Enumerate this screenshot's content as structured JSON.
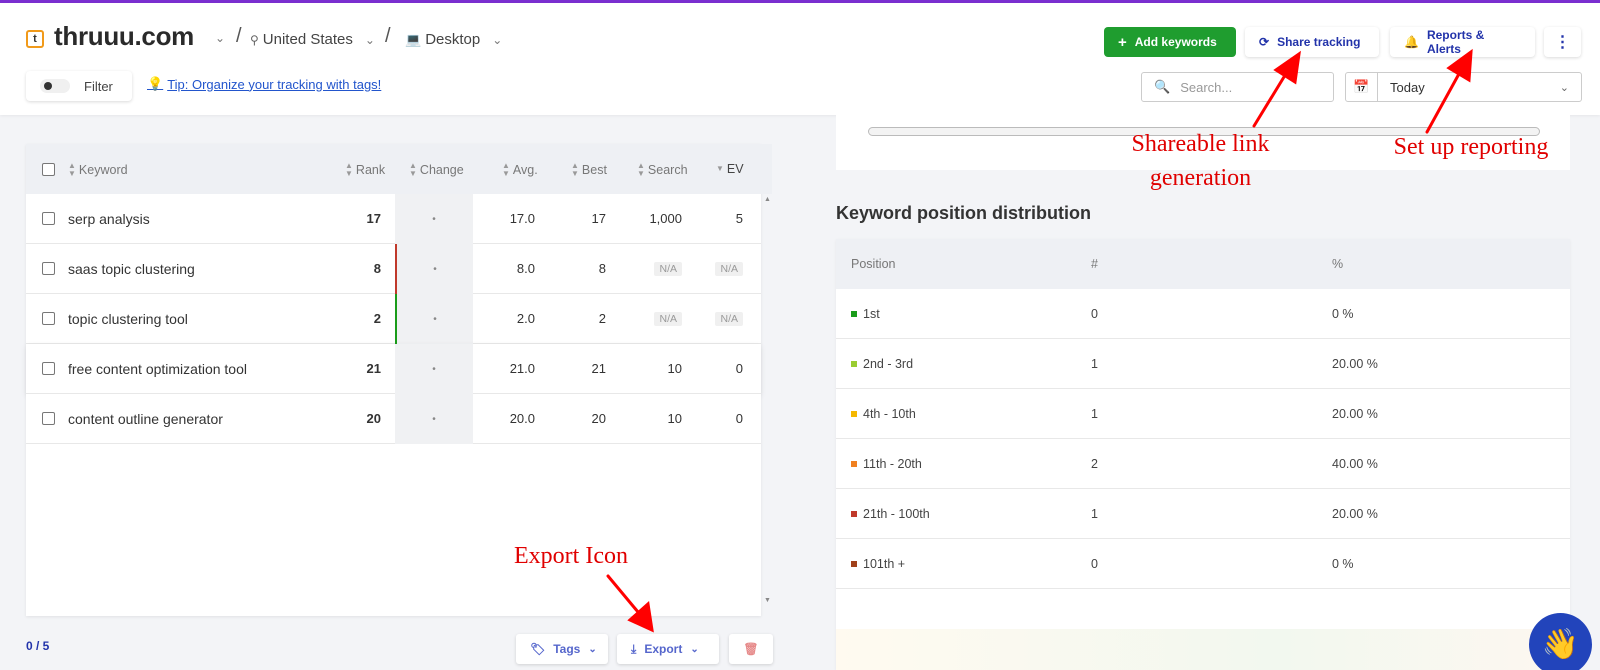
{
  "header": {
    "site_name": "thruuu.com",
    "location": "United States",
    "device": "Desktop",
    "filter_label": "Filter",
    "tip": "Tip: Organize your tracking with tags!",
    "add_keywords": "Add keywords",
    "share_tracking": "Share tracking",
    "reports_alerts": "Reports & Alerts",
    "search_placeholder": "Search...",
    "date": "Today"
  },
  "table": {
    "columns": [
      "Keyword",
      "Rank",
      "Change",
      "Avg.",
      "Best",
      "Search",
      "EV"
    ],
    "rows": [
      {
        "keyword": "serp analysis",
        "rank": "17",
        "change": "•",
        "avg": "17.0",
        "best": "17",
        "search": "1,000",
        "ev": "5"
      },
      {
        "keyword": "saas topic clustering",
        "rank": "8",
        "change": "•",
        "avg": "8.0",
        "best": "8",
        "search": "N/A",
        "ev": "N/A"
      },
      {
        "keyword": "topic clustering tool",
        "rank": "2",
        "change": "•",
        "avg": "2.0",
        "best": "2",
        "search": "N/A",
        "ev": "N/A"
      },
      {
        "keyword": "free content optimization tool",
        "rank": "21",
        "change": "•",
        "avg": "21.0",
        "best": "21",
        "search": "10",
        "ev": "0"
      },
      {
        "keyword": "content outline generator",
        "rank": "20",
        "change": "•",
        "avg": "20.0",
        "best": "20",
        "search": "10",
        "ev": "0"
      }
    ],
    "count": "0 / 5",
    "tags_label": "Tags",
    "export_label": "Export"
  },
  "distribution": {
    "title": "Keyword position distribution",
    "columns": [
      "Position",
      "#",
      "%"
    ],
    "rows": [
      {
        "position": "1st",
        "count": "0",
        "pct": "0 %",
        "color": "#1a9c1a"
      },
      {
        "position": "2nd - 3rd",
        "count": "1",
        "pct": "20.00 %",
        "color": "#9acd32"
      },
      {
        "position": "4th - 10th",
        "count": "1",
        "pct": "20.00 %",
        "color": "#f5b800"
      },
      {
        "position": "11th - 20th",
        "count": "2",
        "pct": "40.00 %",
        "color": "#f08020"
      },
      {
        "position": "21th - 100th",
        "count": "1",
        "pct": "20.00 %",
        "color": "#c0392b"
      },
      {
        "position": "101th +",
        "count": "0",
        "pct": "0 %",
        "color": "#a0401a"
      }
    ]
  },
  "annotations": {
    "share": "Shareable link",
    "share2": "generation",
    "reporting": "Set up reporting",
    "export": "Export Icon"
  }
}
